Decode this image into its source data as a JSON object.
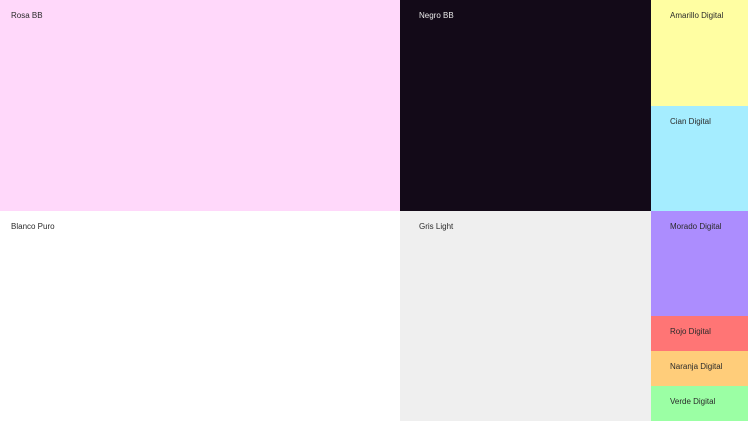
{
  "swatches": {
    "rosa": {
      "label": "Rosa BB",
      "color": "#FFD8FA",
      "text_color": "#2a2a2a"
    },
    "negro": {
      "label": "Negro BB",
      "color": "#130A18",
      "text_color": "#e8e8e8"
    },
    "amarillo": {
      "label": "Amarillo Digital",
      "color": "#FFFEA2",
      "text_color": "#2a2a2a"
    },
    "cian": {
      "label": "Cian Digital",
      "color": "#A5EDFF",
      "text_color": "#2a2a2a"
    },
    "blanco": {
      "label": "Blanco Puro",
      "color": "#FFFFFF",
      "text_color": "#2a2a2a"
    },
    "gris": {
      "label": "Gris Light",
      "color": "#EFEFEF",
      "text_color": "#2a2a2a"
    },
    "morado": {
      "label": "Morado Digital",
      "color": "#AC8DFE",
      "text_color": "#2a2a2a"
    },
    "rojo": {
      "label": "Rojo Digital",
      "color": "#FF7575",
      "text_color": "#2a2a2a"
    },
    "naranja": {
      "label": "Naranja Digital",
      "color": "#FFCD7A",
      "text_color": "#2a2a2a"
    },
    "verde": {
      "label": "Verde Digital",
      "color": "#9BFFA4",
      "text_color": "#2a2a2a"
    }
  }
}
